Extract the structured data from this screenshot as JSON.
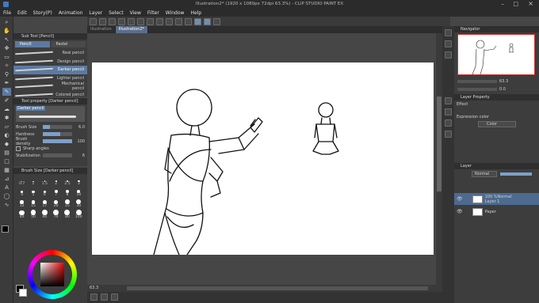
{
  "window": {
    "title": "Illustration2* (1920 x 1080px 72dpi 63.3%) - CLIP STUDIO PAINT EX"
  },
  "menu": [
    "File",
    "Edit",
    "Story(P)",
    "Animation",
    "Layer",
    "Select",
    "View",
    "Filter",
    "Window",
    "Help"
  ],
  "doc_tabs": [
    {
      "label": "Illustration",
      "active": false
    },
    {
      "label": "Illustration2*",
      "active": true
    }
  ],
  "sub_tool": {
    "title": "Sub Tool [Pencil]",
    "groups": [
      {
        "label": "Pencil",
        "active": true
      },
      {
        "label": "Pastel",
        "active": false
      }
    ],
    "items": [
      {
        "label": "Real pencil",
        "selected": false
      },
      {
        "label": "Design pencil",
        "selected": false
      },
      {
        "label": "Darker pencil",
        "selected": true
      },
      {
        "label": "Lighter pencil",
        "selected": false
      },
      {
        "label": "Mechanical pencil",
        "selected": false
      },
      {
        "label": "Colored pencil",
        "selected": false
      }
    ]
  },
  "tool_property": {
    "title": "Tool property [Darker pencil]",
    "preview_label": "Darker pencil",
    "brush_size": {
      "label": "Brush Size",
      "value": "6.0",
      "fraction": 0.25
    },
    "hardness": {
      "label": "Hardness",
      "fraction": 0.6
    },
    "brush_density": {
      "label": "Brush density",
      "value": "100",
      "fraction": 1.0
    },
    "sharp_angles": {
      "label": "Sharp angles"
    },
    "stabilization": {
      "label": "Stabilization",
      "value": "6"
    }
  },
  "brush_size_panel": {
    "title": "Brush Size [Darker pencil]",
    "sizes": [
      "0.7",
      "1",
      "1.5",
      "2",
      "2.5",
      "3",
      "4",
      "5",
      "6",
      "7",
      "8",
      "10",
      "12",
      "15",
      "17",
      "20",
      "25",
      "30",
      "40",
      "50",
      "60",
      "70",
      "80",
      "100"
    ]
  },
  "status": {
    "zoom": "63.3"
  },
  "navigator": {
    "title": "Navigator",
    "zoom": "63.3",
    "angle": "0.0"
  },
  "layer_property": {
    "title": "Layer Property",
    "effect_label": "Effect",
    "expression_color_label": "Expression color",
    "color_value": "Color"
  },
  "layers_panel": {
    "tab": "Layer",
    "blend_mode": "Normal",
    "layers": [
      {
        "opacity": "100 %Normal",
        "name": "Layer 1",
        "selected": true
      },
      {
        "opacity": "",
        "name": "Paper",
        "selected": false
      }
    ]
  },
  "colors": {
    "accent": "#5c7aa0",
    "canvas": "#ffffff",
    "main_color": "#000000",
    "sub_color": "#ffffff"
  }
}
